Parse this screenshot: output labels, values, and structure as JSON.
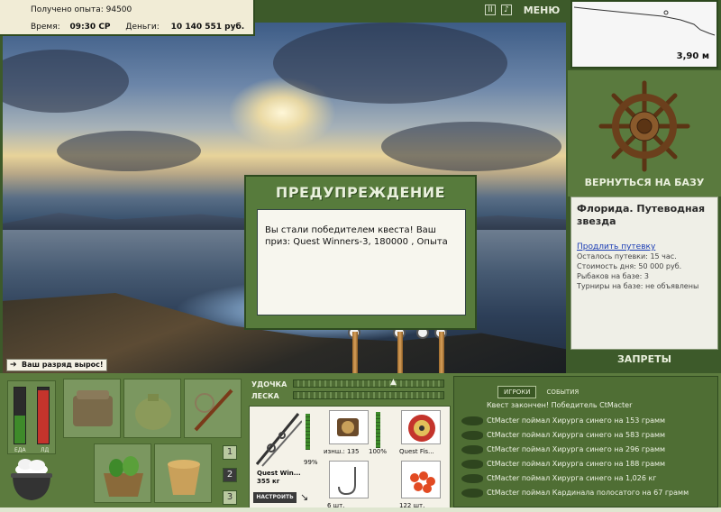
{
  "top_info": {
    "experience_label": "Получено опыта:",
    "experience_value": "94500",
    "time_label": "Время:",
    "time_value": "09:30 СР",
    "money_label": "Деньги:",
    "money_value": "10 140 551 руб."
  },
  "header": {
    "menu_label": "МЕНЮ"
  },
  "depth": {
    "value": "3,90 м"
  },
  "dialog": {
    "title": "ПРЕДУПРЕЖДЕНИЕ",
    "message": "Вы стали победителем квеста! Ваш приз: Quest Winners-3, 180000 , Опыта"
  },
  "rank_message": "Ваш разряд вырос!",
  "right_panel": {
    "return_base": "ВЕРНУТЬСЯ НА БАЗУ",
    "location": "Флорида. Путеводная звезда",
    "extend_link": "Продлить путевку",
    "lines": [
      "Осталось путевки: 15 час.",
      "Стоимость дня: 50 000 руб.",
      "Рыбаков на базе: 3",
      "Турниры на базе: не объявлены"
    ],
    "bans": "ЗАПРЕТЫ"
  },
  "status_bars": {
    "food_label": "ЕДА",
    "food_level": 0.5,
    "ice_label": "ЛД",
    "ice_level": 0.95
  },
  "page_buttons": [
    "1",
    "2",
    "3"
  ],
  "rod_panel": {
    "rod_label": "УДОЧКА",
    "line_label": "ЛЕСКА",
    "rod_name": "Quest Win...",
    "rod_weight": "355 кг",
    "rod_percent": "99%",
    "setup_button": "НАСТРОИТЬ",
    "reel_wear": "изнш.: 135",
    "reel_percent": "100%",
    "bait_name": "Quest Fis...",
    "hook_count": "6 шт.",
    "bait_count": "122 шт."
  },
  "events": {
    "tabs": [
      "ИГРОКИ",
      "СОБЫТИЯ"
    ],
    "header": "Квест закончен! Победитель CtMacter",
    "rows": [
      "CtMacter поймал Хирурга синего на 153 грамм",
      "CtMacter поймал Хирурга синего на 583 грамм",
      "CtMacter поймал Хирурга синего на 296 грамм",
      "CtMacter поймал Хирурга синего на 188 грамм",
      "CtMacter поймал Хирурга синего на 1,026 кг",
      "CtMacter поймал Кардинала полосатого на 67 грамм"
    ]
  },
  "colors": {
    "panel_green": "#5c7b3e",
    "dark_green": "#2f4a1f",
    "link_blue": "#1b3db5"
  }
}
